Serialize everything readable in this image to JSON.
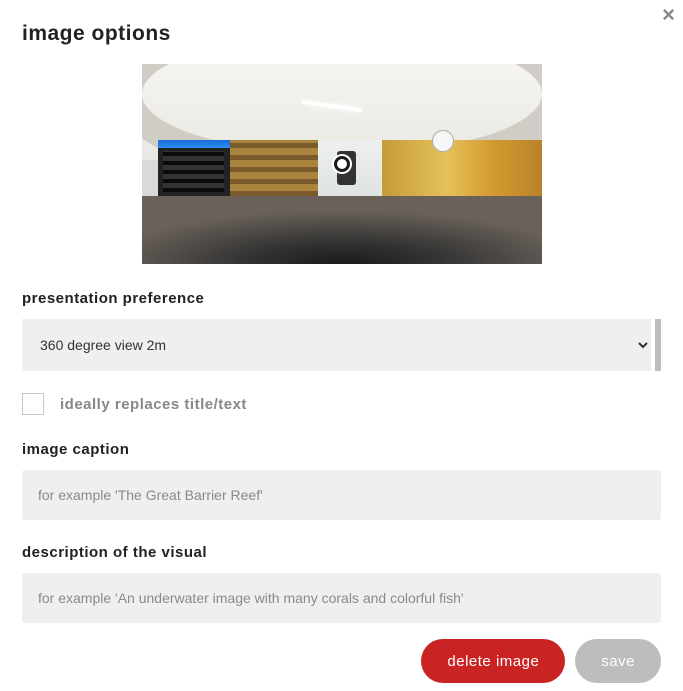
{
  "dialog": {
    "title": "image options",
    "close_glyph": "×"
  },
  "presentation": {
    "label": "presentation preference",
    "selected": "360 degree view 2m"
  },
  "replace": {
    "label": "ideally replaces title/text",
    "checked": false
  },
  "caption": {
    "label": "image caption",
    "placeholder": "for example 'The Great Barrier Reef'",
    "value": ""
  },
  "description": {
    "label": "description of the visual",
    "placeholder": "for example 'An underwater image with many corals and colorful fish'",
    "value": ""
  },
  "actions": {
    "delete_label": "delete image",
    "save_label": "save"
  }
}
